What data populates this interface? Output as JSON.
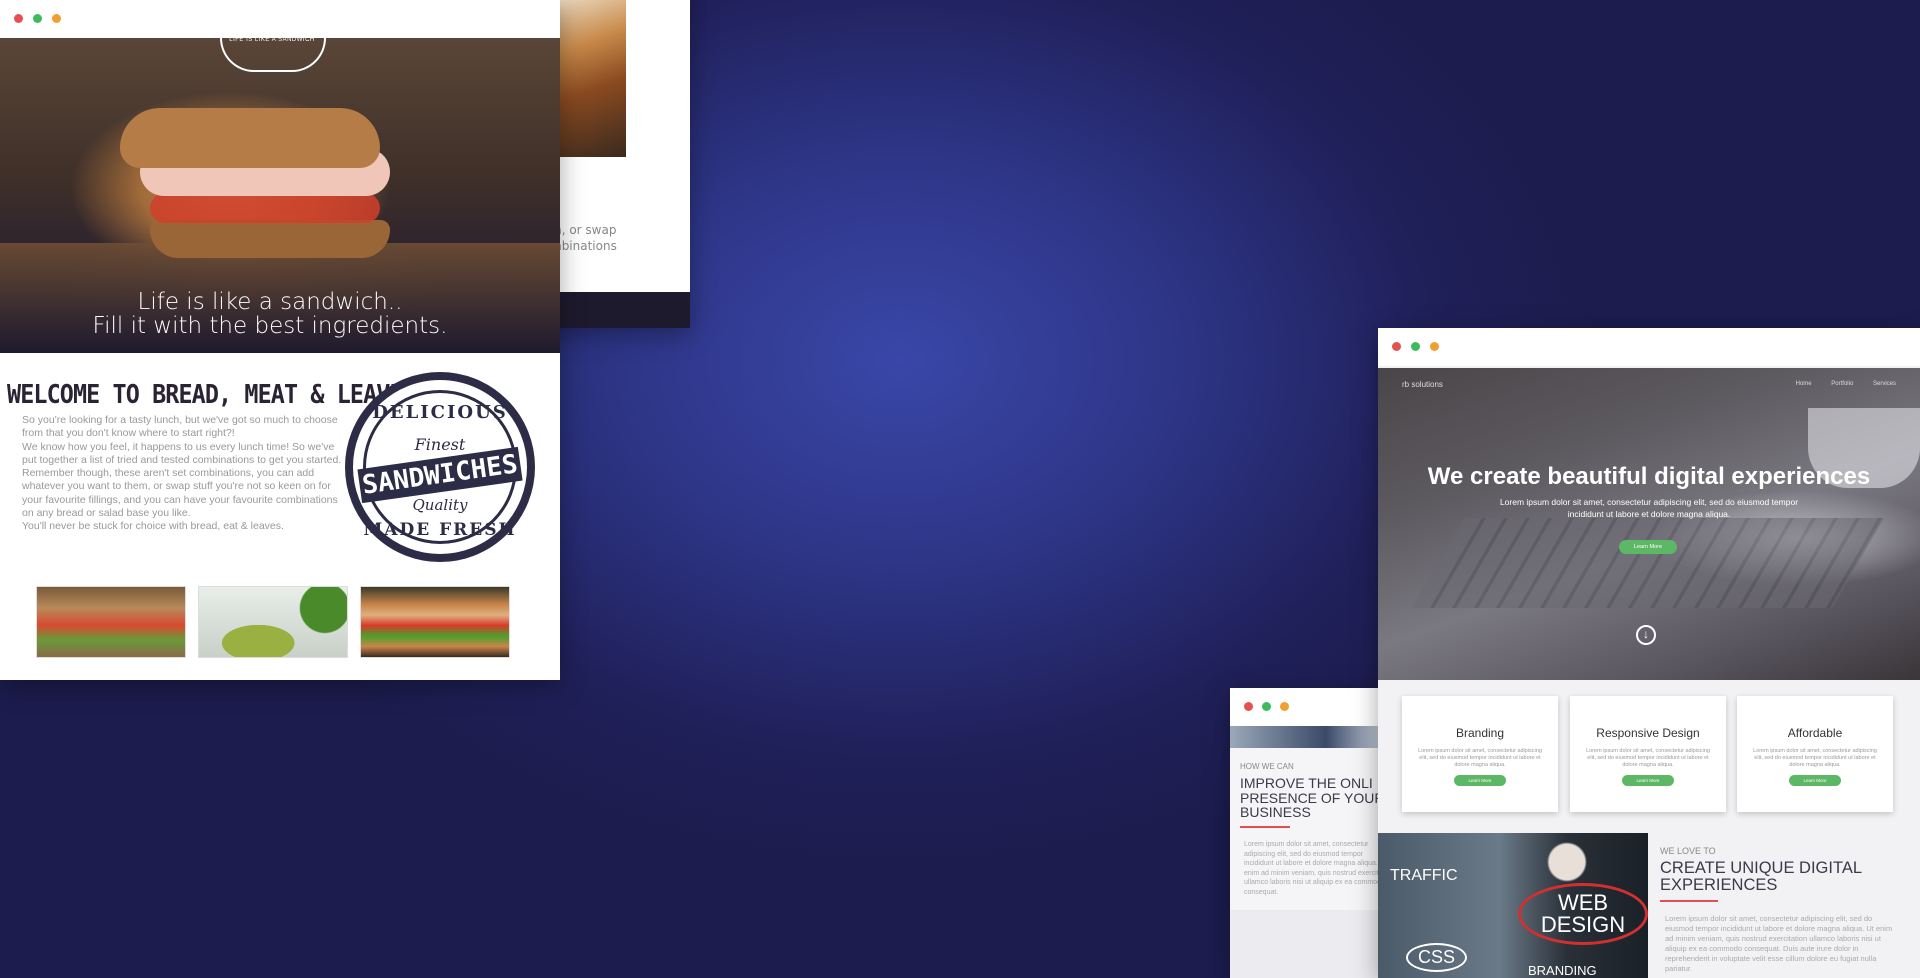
{
  "sandwich_back": {
    "text_lines": [
      "m, or swap",
      "mbinations"
    ]
  },
  "sandwich_site": {
    "badge_text": "LIFE IS LIKE A SANDWICH",
    "tagline_line1": "Life is like a sandwich..",
    "tagline_line2": "Fill it with the best ingredients.",
    "welcome_heading": "WELCOME TO BREAD, MEAT & LEAVES",
    "paragraphs": [
      "So you're looking for a tasty lunch, but we've got so much to choose from that you don't know where to start right?!",
      "We know how you feel, it happens to us every lunch time! So we've put together a list of tried and tested combinations to get you started.",
      "Remember though, these aren't set combinations, you can add whatever you want to them, or swap stuff you're not so keen on for your favourite fillings, and you can have your favourite combinations on any bread or salad base you like.",
      "You'll never be stuck for choice with bread, eat & leaves."
    ],
    "stamp": {
      "top": "DELICIOUS",
      "finest": "Finest",
      "main": "SANDWICHES",
      "quality": "Quality",
      "bottom": "MADE FRESH"
    }
  },
  "rb_site": {
    "brand": "rb solutions",
    "nav": [
      "Home",
      "Portfolio",
      "Services"
    ],
    "headline": "We create beautiful digital experiences",
    "subtext": "Lorem ipsum dolor sit amet, consectetur adipiscing elit, sed do eiusmod tempor incididunt ut labore et dolore magna aliqua.",
    "cta": "Learn More",
    "cards": [
      {
        "title": "Branding",
        "text": "Lorem ipsum dolor sit amet, consectetur adipiscing elit, sed do eiusmod tempor incididunt ut labore et dolore magna aliqua.",
        "button": "Learn More"
      },
      {
        "title": "Responsive Design",
        "text": "Lorem ipsum dolor sit amet, consectetur adipiscing elit, sed do eiusmod tempor incididunt ut labore et dolore magna aliqua.",
        "button": "Learn More"
      },
      {
        "title": "Affordable",
        "text": "Lorem ipsum dolor sit amet, consectetur adipiscing elit, sed do eiusmod tempor incididunt ut labore et dolore magna aliqua.",
        "button": "Learn More"
      }
    ],
    "image_words": [
      "TRAFFIC",
      "WEB DESIGN",
      "CSS",
      "BRANDING"
    ],
    "love_label": "WE LOVE TO",
    "love_heading": "CREATE UNIQUE DIGITAL EXPERIENCES",
    "love_text": "Lorem ipsum dolor sit amet, consectetur adipiscing elit, sed do eiusmod tempor incididunt ut labore et dolore magna aliqua. Ut enim ad minim veniam, quis nostrud exercitation ullamco laboris nisi ut aliquip ex ea commodo consequat. Duis aute irure dolor in reprehenderit in voluptate velit esse cillum dolore eu fugiat nulla pariatur."
  },
  "rb_back": {
    "label": "HOW WE CAN",
    "heading_lines": [
      "IMPROVE THE ONLI",
      "PRESENCE OF YOUR",
      "BUSINESS"
    ],
    "text": "Lorem ipsum dolor sit amet, consectetur adipiscing elit, sed do eiusmod tempor incididunt ut labore et dolore magna aliqua. Ut enim ad minim veniam, quis nostrud exercitation ullamco laboris nisi ut aliquip ex ea commodo consequat."
  },
  "colors": {
    "window_dot_red": "#e55050",
    "window_dot_green": "#3dbb5c",
    "window_dot_orange": "#f0a030",
    "cta_green": "#5cb865",
    "accent_red": "#e05050"
  }
}
